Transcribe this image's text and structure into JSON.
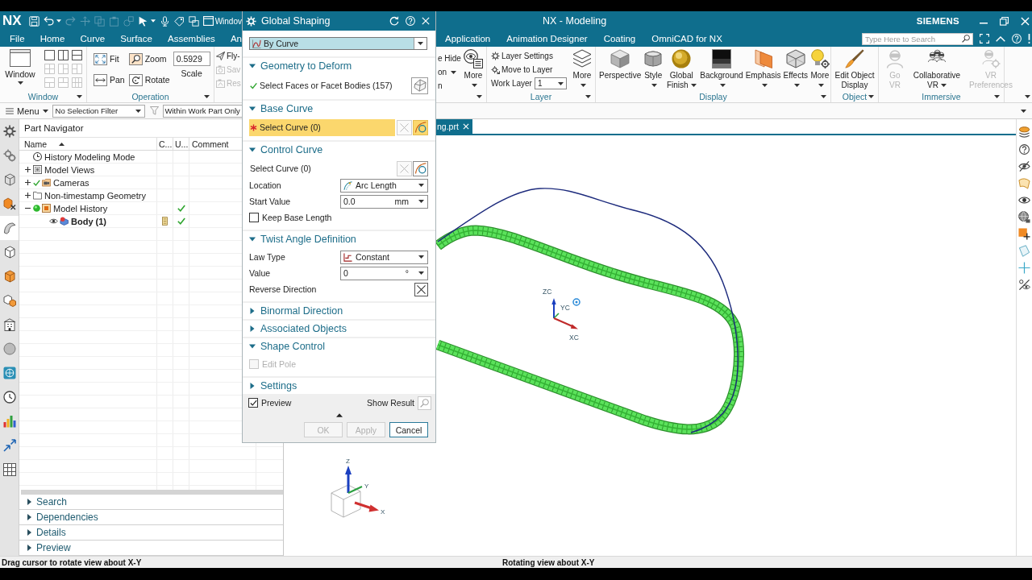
{
  "title_bar": {
    "logo": "NX",
    "quick_access": [
      {
        "disabled": false,
        "dropdown": false
      },
      {
        "disabled": false,
        "dropdown": true
      },
      {
        "disabled": true,
        "dropdown": false
      },
      {
        "disabled": true,
        "dropdown": false
      },
      {
        "disabled": true,
        "dropdown": false
      },
      {
        "disabled": true,
        "dropdown": false
      },
      {
        "disabled": true,
        "dropdown": false
      },
      {
        "disabled": false,
        "dropdown": true
      },
      {
        "disabled": false,
        "dropdown": false
      },
      {
        "disabled": false,
        "dropdown": false
      },
      {
        "disabled": false,
        "dropdown": false
      }
    ],
    "window_menu": "Windov",
    "title": "NX - Modeling",
    "brand": "SIEMENS"
  },
  "menu_bar": {
    "left_tabs": [
      "File",
      "Home",
      "Curve",
      "Surface",
      "Assemblies",
      "An"
    ],
    "right_tabs": [
      "Application",
      "Animation Designer",
      "Coating",
      "OmniCAD for NX"
    ],
    "search": {
      "placeholder": "Type Here to Search"
    }
  },
  "ribbon": {
    "window_group": {
      "label": "Window",
      "button": {
        "label": "Window",
        "dropdown": true
      },
      "layouts": [
        {
          "disabled": false
        },
        {
          "disabled": false
        },
        {
          "disabled": false
        },
        {
          "disabled": true
        },
        {
          "disabled": true
        },
        {
          "disabled": true
        },
        {
          "disabled": true
        },
        {
          "disabled": true
        },
        {
          "disabled": true
        }
      ]
    },
    "operation_group": {
      "label": "Operation",
      "buttons": [
        "Fit",
        "Pan",
        "Zoom",
        "Rotate"
      ],
      "scale": {
        "value": "0.5929",
        "label": "Scale"
      }
    },
    "cut_group_left": {
      "items": [
        {
          "label": "Fly-",
          "disabled": false
        },
        {
          "label": "Sav",
          "disabled": true
        },
        {
          "label": "Res",
          "disabled": true
        }
      ]
    },
    "cut_group_right": {
      "items": [
        {
          "label": "e Hide",
          "dropdown": false
        },
        {
          "label": "on",
          "dropdown": true
        },
        {
          "label": "n",
          "dropdown": false
        }
      ],
      "more": {
        "label": "More",
        "dropdown": true
      }
    },
    "layer_group": {
      "label": "Layer",
      "items": [
        "Layer Settings",
        "Move to Layer"
      ],
      "work_layer": {
        "label": "Work Layer",
        "value": "1"
      },
      "more": {
        "label": "More",
        "dropdown": true
      }
    },
    "display_group": {
      "label": "Display",
      "buttons": [
        {
          "kind": "perspective",
          "label": "Perspective",
          "dropdown": false
        },
        {
          "kind": "style",
          "label": "Style",
          "dropdown": true
        },
        {
          "kind": "finish",
          "label": "Global Finish",
          "dropdown": true
        },
        {
          "kind": "background",
          "label": "Background",
          "dropdown": true
        },
        {
          "kind": "emphasis",
          "label": "Emphasis",
          "dropdown": true
        },
        {
          "kind": "effects",
          "label": "Effects",
          "dropdown": true
        },
        {
          "kind": "more",
          "label": "More",
          "dropdown": true
        }
      ]
    },
    "object_group": {
      "label": "Object",
      "buttons": [
        {
          "kind": "brush",
          "label": "Edit Object Display",
          "dropdown": false,
          "disabled": false
        }
      ]
    },
    "immersive_group": {
      "label": "Immersive",
      "buttons": [
        {
          "kind": "vr",
          "label": "Go VR",
          "dropdown": false,
          "disabled": true
        },
        {
          "kind": "collab",
          "label": "Collaborative VR",
          "dropdown": true,
          "disabled": false
        },
        {
          "kind": "vr_prefs",
          "label": "VR Preferences",
          "dropdown": false,
          "disabled": true
        }
      ]
    }
  },
  "selection_bar": {
    "menu": "Menu",
    "filter": "No Selection Filter",
    "scope": "Within Work Part Only"
  },
  "resource_bar": [
    {
      "selected": false
    },
    {
      "selected": false
    },
    {
      "selected": false
    },
    {
      "selected": false
    },
    {
      "selected": true
    },
    {
      "selected": false
    },
    {
      "selected": false
    },
    {
      "selected": false
    },
    {
      "selected": false
    },
    {
      "selected": false
    },
    {
      "selected": false
    },
    {
      "selected": false
    },
    {
      "selected": false
    },
    {
      "selected": false
    },
    {
      "selected": false
    }
  ],
  "navigator": {
    "title": "Part Navigator",
    "columns": [
      "Name",
      "C...",
      "U...",
      "Comment"
    ],
    "rows": [
      {
        "kind": "mode",
        "name": "History Modeling Mode",
        "checked": false,
        "up_to_date": false,
        "marker": false,
        "current": false
      },
      {
        "kind": "views",
        "name": "Model Views",
        "expanded": false,
        "checked": false,
        "up_to_date": false,
        "marker": false,
        "current": false
      },
      {
        "kind": "cameras",
        "name": "Cameras",
        "expanded": false,
        "checked": true,
        "up_to_date": false,
        "marker": false,
        "current": false
      },
      {
        "kind": "folder",
        "name": "Non-timestamp Geometry",
        "expanded": false,
        "checked": false,
        "up_to_date": false,
        "marker": false,
        "current": false
      },
      {
        "kind": "history",
        "name": "Model History",
        "expanded": true,
        "checked": false,
        "up_to_date": true,
        "marker": false,
        "current": false,
        "children": [
          {
            "kind": "body",
            "name": "Body (1)",
            "checked": false,
            "up_to_date": true,
            "marker": true,
            "current": true
          }
        ]
      }
    ],
    "panels": [
      {
        "label": "Search",
        "expanded": false
      },
      {
        "label": "Dependencies",
        "expanded": false
      },
      {
        "label": "Details",
        "expanded": false
      },
      {
        "label": "Preview",
        "expanded": false
      }
    ]
  },
  "graphics": {
    "tab": {
      "label": "ng.prt",
      "selected": true
    },
    "wcs_labels": [
      "ZC",
      "YC",
      "XC"
    ],
    "view_labels": [
      "Z",
      "Y",
      "X"
    ]
  },
  "status_bar": {
    "prompt": "Drag cursor to rotate view about X-Y",
    "message": "Rotating view about X-Y"
  },
  "dialog": {
    "title": "Global Shaping",
    "type": "By Curve",
    "sections": [
      {
        "title": "Geometry to Deform",
        "expanded": true,
        "rows": [
          {
            "kind": "face_selection",
            "label": "Select Faces or Facet Bodies (157)",
            "done": true,
            "required": false,
            "active": false
          }
        ]
      },
      {
        "title": "Base Curve",
        "expanded": true,
        "rows": [
          {
            "kind": "curve_selection",
            "label": "Select Curve (0)",
            "done": false,
            "required": true,
            "active": true
          }
        ]
      },
      {
        "title": "Control Curve",
        "expanded": true,
        "rows": [
          {
            "kind": "curve_selection",
            "label": "Select Curve (0)",
            "done": false,
            "required": false,
            "active": false
          },
          {
            "kind": "arc_dropdown",
            "label": "Location",
            "value": "Arc Length"
          },
          {
            "kind": "number",
            "label": "Start Value",
            "value": "0.0",
            "unit": "mm"
          },
          {
            "kind": "checkbox",
            "label": "Keep Base Length",
            "checked": false,
            "disabled": false
          }
        ]
      },
      {
        "title": "Twist Angle Definition",
        "expanded": true,
        "rows": [
          {
            "kind": "law_dropdown",
            "label": "Law Type",
            "value": "Constant"
          },
          {
            "kind": "number",
            "label": "Value",
            "value": "0",
            "unit": "°"
          },
          {
            "kind": "toggle_button",
            "label": "Reverse Direction"
          }
        ]
      },
      {
        "title": "Binormal Direction",
        "expanded": false
      },
      {
        "title": "Associated Objects",
        "expanded": false
      },
      {
        "title": "Shape Control",
        "expanded": true,
        "rows": [
          {
            "kind": "checkbox",
            "label": "Edit Pole",
            "checked": false,
            "disabled": true
          }
        ]
      },
      {
        "title": "Settings",
        "expanded": false
      }
    ],
    "footer": {
      "preview": {
        "label": "Preview",
        "checked": true
      },
      "show_result": "Show Result",
      "buttons": [
        {
          "label": "OK",
          "disabled": true,
          "focused": false
        },
        {
          "label": "Apply",
          "disabled": true,
          "focused": false
        },
        {
          "label": "Cancel",
          "disabled": false,
          "focused": true
        }
      ]
    }
  }
}
